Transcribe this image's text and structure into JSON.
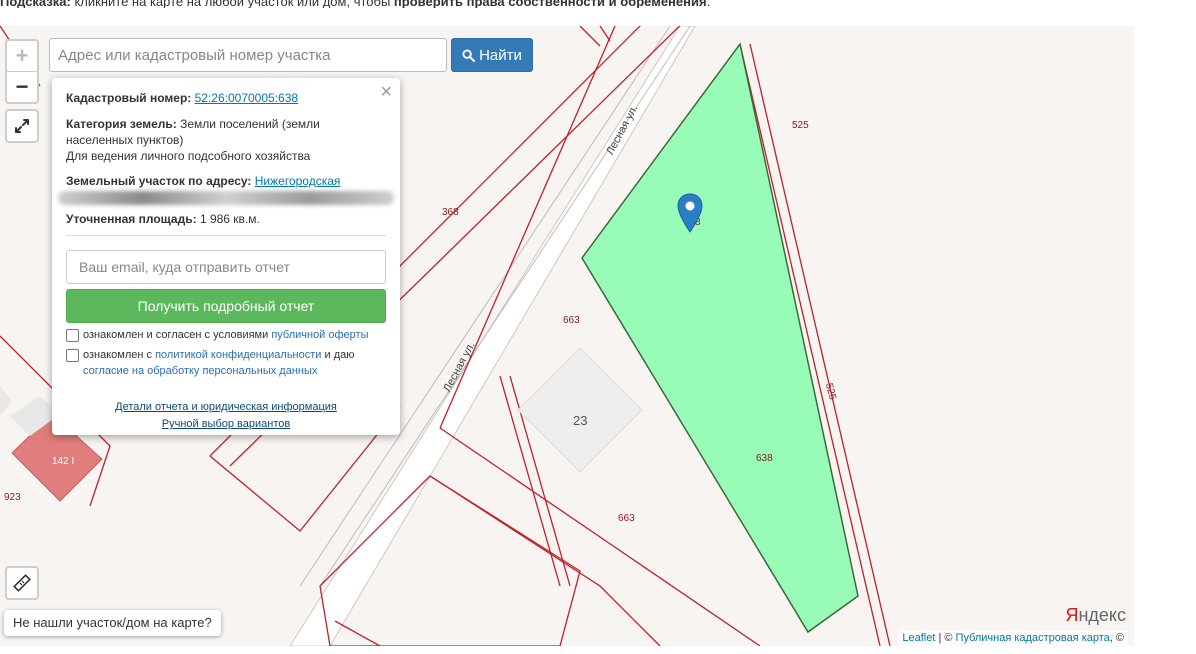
{
  "hint": {
    "prefix": "Подсказка:",
    "middle": " кликните на карте на любой участок или дом, чтобы ",
    "bold_end": "проверить права собственности и обременения",
    "suffix": "."
  },
  "search": {
    "placeholder": "Адрес или кадастровый номер участка",
    "button_label": "Найти"
  },
  "zoom": {
    "in": "+",
    "out": "−"
  },
  "popup": {
    "cadastral_label": "Кадастровый номер:",
    "cadastral_value": "52:26:0070005:638",
    "category_label": "Категория земель:",
    "category_value": "Земли поселений (земли населенных пунктов)",
    "usage": "Для ведения личного подсобного хозяйства",
    "address_label": "Земельный участок по адресу:",
    "address_value": "Нижегородская",
    "area_label": "Уточненная площадь:",
    "area_value": "1 986 кв.м.",
    "email_placeholder": "Ваш email, куда отправить отчет",
    "report_button": "Получить подробный отчет",
    "consent1_text": "ознакомлен и согласен с условиями ",
    "consent1_link": "публичной оферты",
    "consent2_text": "ознакомлен с ",
    "consent2_link": "политикой конфиденциальности",
    "consent2_mid": " и даю ",
    "consent2_link2": "согласие на обработку персональных данных",
    "details_link": "Детали отчета и юридическая информация",
    "manual_link": "Ручной выбор вариантов"
  },
  "map_labels": {
    "l525a": "525",
    "l525b": "525",
    "l368": "368",
    "l663a": "663",
    "l663b": "663",
    "l638": "638",
    "l8": "8",
    "l23": "23",
    "l1421": "142 I",
    "l923": "923",
    "street1": "Лесная ул.",
    "street2": "Лесная ул."
  },
  "not_found": "Не нашли участок/дом на карте?",
  "yandex": {
    "y": "Я",
    "rest": "ндекс"
  },
  "attribution": {
    "leaflet": "Leaflet",
    "sep": " | © ",
    "pkk": "Публичная кадастровая карта",
    "suffix": ", ©"
  },
  "colors": {
    "parcel_fill": "#98fcb8",
    "parcel_stroke": "#3a6b3a",
    "boundary": "#c0202a",
    "button_blue": "#337ab7",
    "button_green": "#5cb85c"
  }
}
